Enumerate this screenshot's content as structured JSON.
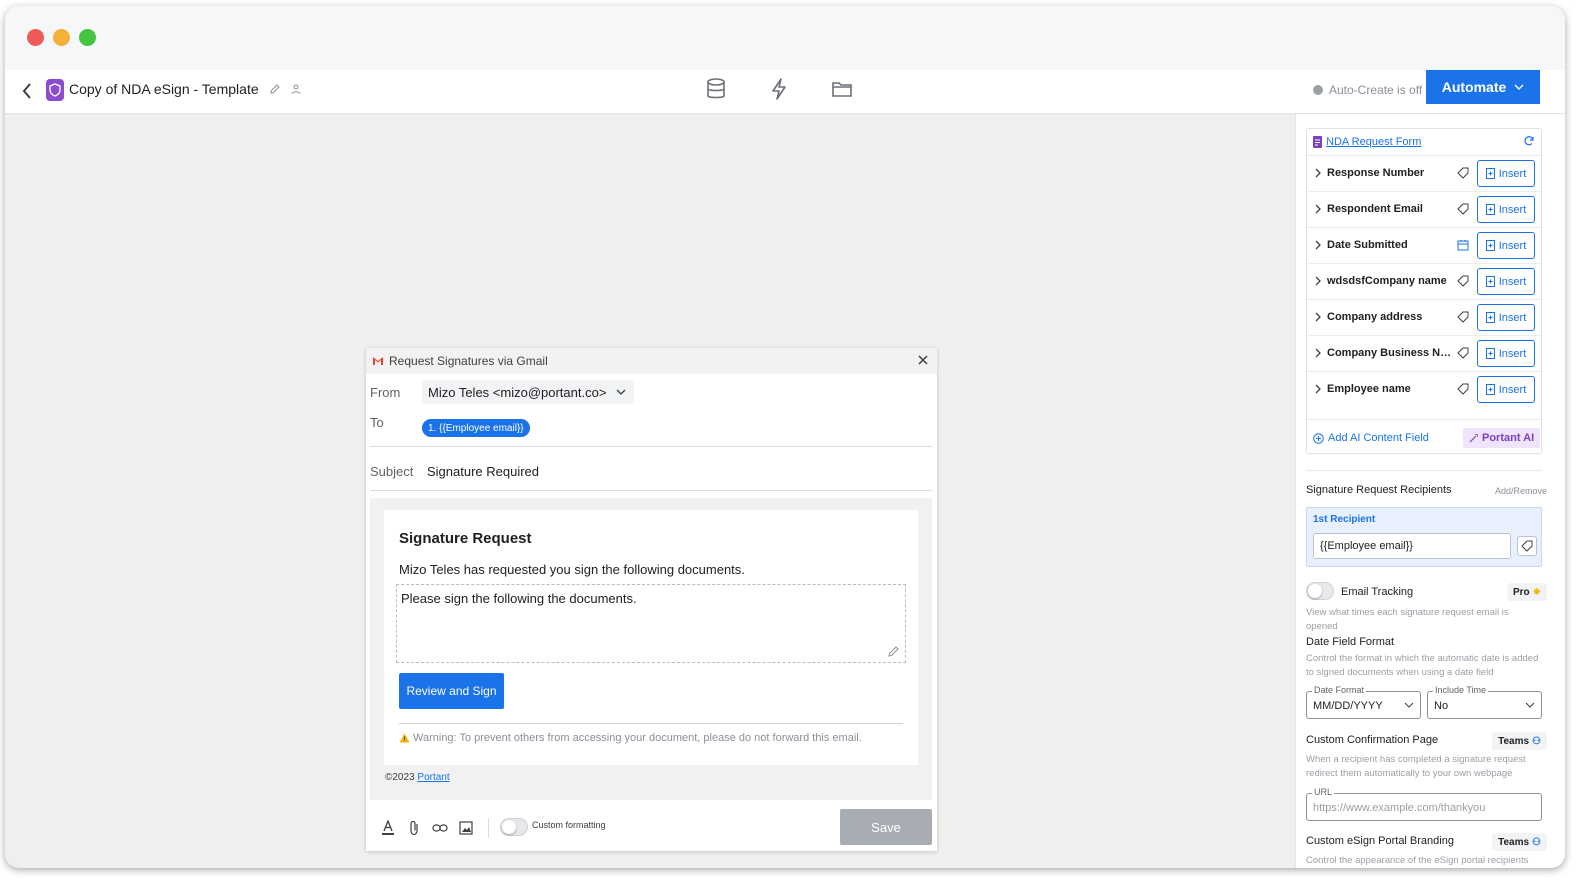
{
  "window": {
    "doc_title": "Copy of NDA eSign - Template"
  },
  "toolbar": {
    "autocreate_status": "Auto-Create is off",
    "automate_label": "Automate"
  },
  "dialog": {
    "title": "Request Signatures via Gmail",
    "from_label": "From",
    "from_value": "Mizo Teles <mizo@portant.co>",
    "to_label": "To",
    "to_chip": "1. {{Employee email}}",
    "subject_label": "Subject",
    "subject_value": "Signature Required",
    "mail": {
      "title": "Signature Request",
      "intro": "Mizo Teles has requested you sign the following documents.",
      "message": "Please sign the following the documents.",
      "button": "Review and Sign",
      "warning": "Warning: To prevent others from accessing your document, please do not forward this email."
    },
    "copyright_prefix": "©2023",
    "copyright_link": "Portant",
    "custom_formatting_label": "Custom formatting",
    "save_label": "Save"
  },
  "panel": {
    "form_name": "NDA Request Form",
    "insert_label": "Insert",
    "fields": [
      {
        "name": "Response Number",
        "type_icon": "tag-icon"
      },
      {
        "name": "Respondent Email",
        "type_icon": "tag-icon"
      },
      {
        "name": "Date Submitted",
        "type_icon": "calendar-icon"
      },
      {
        "name": "wdsdsfCompany name",
        "type_icon": "tag-icon"
      },
      {
        "name": "Company address",
        "type_icon": "tag-icon"
      },
      {
        "name": "Company Business Num...",
        "type_icon": "tag-icon"
      },
      {
        "name": "Employee name",
        "type_icon": "tag-icon"
      }
    ],
    "add_ai_label": "Add AI Content Field",
    "portant_ai_label": "Portant AI",
    "recipients_title": "Signature Request Recipients",
    "add_remove": "Add/Remove",
    "recipient_label": "1st Recipient",
    "recipient_value": "{{Employee email}}",
    "email_tracking_title": "Email Tracking",
    "email_tracking_badge": "Pro",
    "email_tracking_desc": "View what times each signature request email is opened",
    "date_format_title": "Date Field Format",
    "date_format_desc": "Control the format in which the automatic date is added to signed documents when using a date field",
    "date_format_label": "Date Format",
    "date_format_value": "MM/DD/YYYY",
    "include_time_label": "Include Time",
    "include_time_value": "No",
    "confirm_title": "Custom Confirmation Page",
    "teams_badge": "Teams",
    "confirm_desc": "When a recipient has completed a signature request redirect them automatically to your own webpage",
    "url_label": "URL",
    "url_placeholder": "https://www.example.com/thankyou",
    "branding_title": "Custom eSign Portal Branding",
    "branding_desc": "Control the appearance of the eSign portal recipients will"
  },
  "colors": {
    "accent": "#1a73e8",
    "doc_badge": "#8b4ccf",
    "portant_ai": "#7b3fbf"
  }
}
